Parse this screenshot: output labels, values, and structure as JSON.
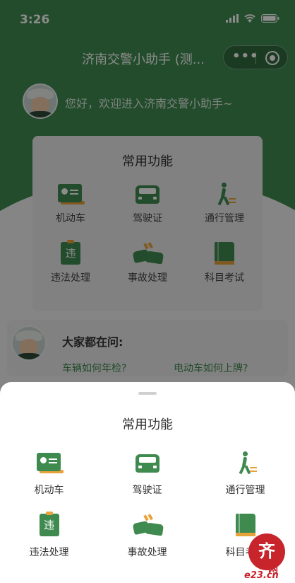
{
  "status_bar": {
    "time": "3:26"
  },
  "navbar": {
    "title": "济南交警小助手 (测..."
  },
  "greeting": "您好，欢迎进入济南交警小助手~",
  "bg_card": {
    "title": "常用功能",
    "items": [
      {
        "label": "机动车",
        "icon": "id-card-icon"
      },
      {
        "label": "驾驶证",
        "icon": "car-icon"
      },
      {
        "label": "通行管理",
        "icon": "walker-icon"
      },
      {
        "label": "违法处理",
        "icon": "violation-icon"
      },
      {
        "label": "事故处理",
        "icon": "accident-icon"
      },
      {
        "label": "科目考试",
        "icon": "book-icon"
      }
    ]
  },
  "ask": {
    "title": "大家都在问:",
    "questions": [
      "车辆如何年检?",
      "电动车如何上牌?"
    ]
  },
  "sheet": {
    "title": "常用功能",
    "items": [
      {
        "label": "机动车",
        "icon": "id-card-icon"
      },
      {
        "label": "驾驶证",
        "icon": "car-icon"
      },
      {
        "label": "通行管理",
        "icon": "walker-icon"
      },
      {
        "label": "违法处理",
        "icon": "violation-icon"
      },
      {
        "label": "事故处理",
        "icon": "accident-icon"
      },
      {
        "label": "科目考试",
        "icon": "book-icon"
      }
    ],
    "violation_glyph": "违"
  },
  "watermark": {
    "text": "齐",
    "sub": "网",
    "url": "e23.cn"
  },
  "colors": {
    "primary": "#3f8a4f",
    "accent": "#e8a23a",
    "link": "#3f8a4f"
  }
}
